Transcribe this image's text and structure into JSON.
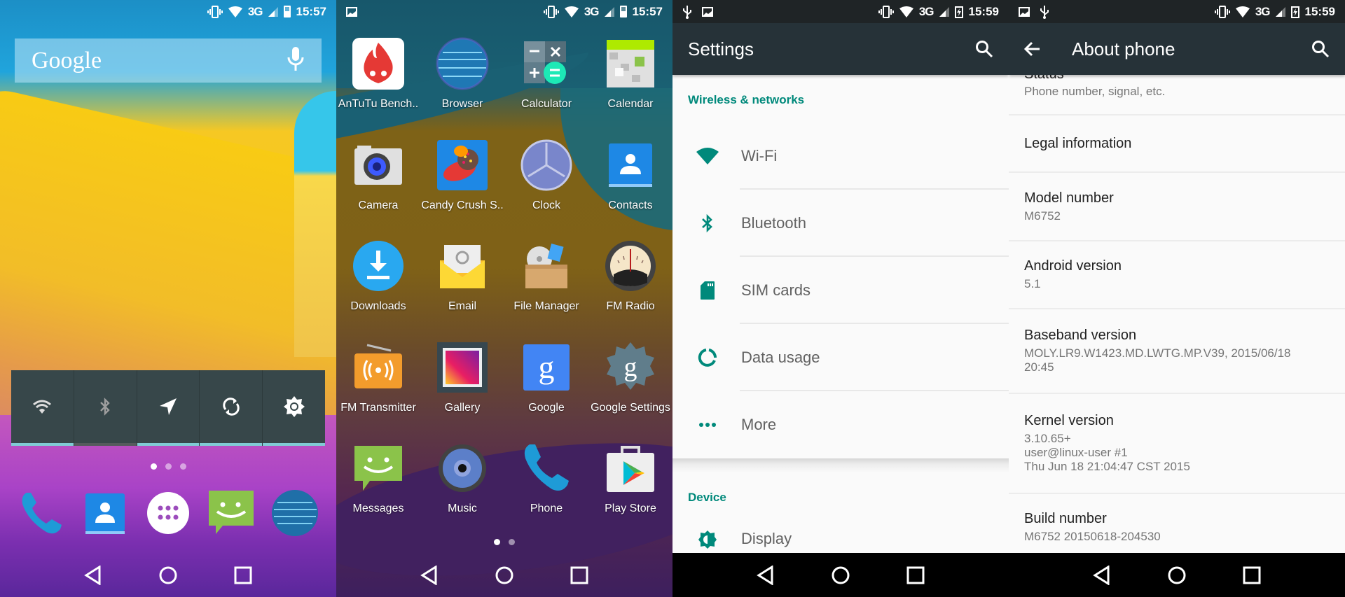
{
  "screens": {
    "home": {
      "status": {
        "time": "15:57",
        "network": "3G"
      },
      "search": {
        "label": "Google"
      },
      "quick_settings": [
        {
          "name": "wifi",
          "state": "on"
        },
        {
          "name": "bluetooth",
          "state": "off"
        },
        {
          "name": "location",
          "state": "on"
        },
        {
          "name": "sync",
          "state": "on"
        },
        {
          "name": "brightness",
          "state": "on"
        }
      ],
      "pages": {
        "count": 3,
        "active": 1
      },
      "dock": [
        "Phone",
        "Contacts",
        "All apps",
        "Messages",
        "Browser"
      ]
    },
    "drawer": {
      "status": {
        "time": "15:57",
        "network": "3G"
      },
      "apps": [
        {
          "label": "AnTuTu Bench..",
          "icon": "antutu-icon"
        },
        {
          "label": "Browser",
          "icon": "globe-icon"
        },
        {
          "label": "Calculator",
          "icon": "calculator-icon"
        },
        {
          "label": "Calendar",
          "icon": "calendar-icon"
        },
        {
          "label": "Camera",
          "icon": "camera-icon"
        },
        {
          "label": "Candy Crush S..",
          "icon": "candy-icon"
        },
        {
          "label": "Clock",
          "icon": "clock-icon"
        },
        {
          "label": "Contacts",
          "icon": "contacts-icon"
        },
        {
          "label": "Downloads",
          "icon": "download-icon"
        },
        {
          "label": "Email",
          "icon": "email-icon"
        },
        {
          "label": "File Manager",
          "icon": "file-manager-icon"
        },
        {
          "label": "FM Radio",
          "icon": "radio-gauge-icon"
        },
        {
          "label": "FM Transmitter",
          "icon": "radio-transmitter-icon"
        },
        {
          "label": "Gallery",
          "icon": "gallery-icon"
        },
        {
          "label": "Google",
          "icon": "google-g-icon"
        },
        {
          "label": "Google Settings",
          "icon": "google-settings-icon"
        },
        {
          "label": "Messages",
          "icon": "messages-icon"
        },
        {
          "label": "Music",
          "icon": "speaker-icon"
        },
        {
          "label": "Phone",
          "icon": "phone-icon"
        },
        {
          "label": "Play Store",
          "icon": "play-store-icon"
        }
      ],
      "pages": {
        "count": 2,
        "active": 1
      }
    },
    "settings": {
      "status": {
        "time": "15:59",
        "network": "3G"
      },
      "title": "Settings",
      "sections": [
        {
          "header": "Wireless & networks",
          "items": [
            "Wi-Fi",
            "Bluetooth",
            "SIM cards",
            "Data usage",
            "More"
          ]
        },
        {
          "header": "Device",
          "items": [
            "Display"
          ]
        }
      ]
    },
    "about": {
      "status": {
        "time": "15:59",
        "network": "3G"
      },
      "title": "About phone",
      "items": [
        {
          "title": "Status",
          "sub": "Phone number, signal, etc."
        },
        {
          "title": "Legal information",
          "sub": ""
        },
        {
          "title": "Model number",
          "sub": "M6752"
        },
        {
          "title": "Android version",
          "sub": "5.1"
        },
        {
          "title": "Baseband version",
          "sub": "MOLY.LR9.W1423.MD.LWTG.MP.V39, 2015/06/18\n20:45"
        },
        {
          "title": "Kernel version",
          "sub": "3.10.65+\nuser@linux-user #1\nThu Jun 18 21:04:47 CST 2015"
        },
        {
          "title": "Build number",
          "sub": "M6752 20150618-204530"
        }
      ]
    }
  },
  "colors": {
    "accent": "#00897b",
    "toolbar": "#263238",
    "qs_active": "#80cbd4"
  }
}
